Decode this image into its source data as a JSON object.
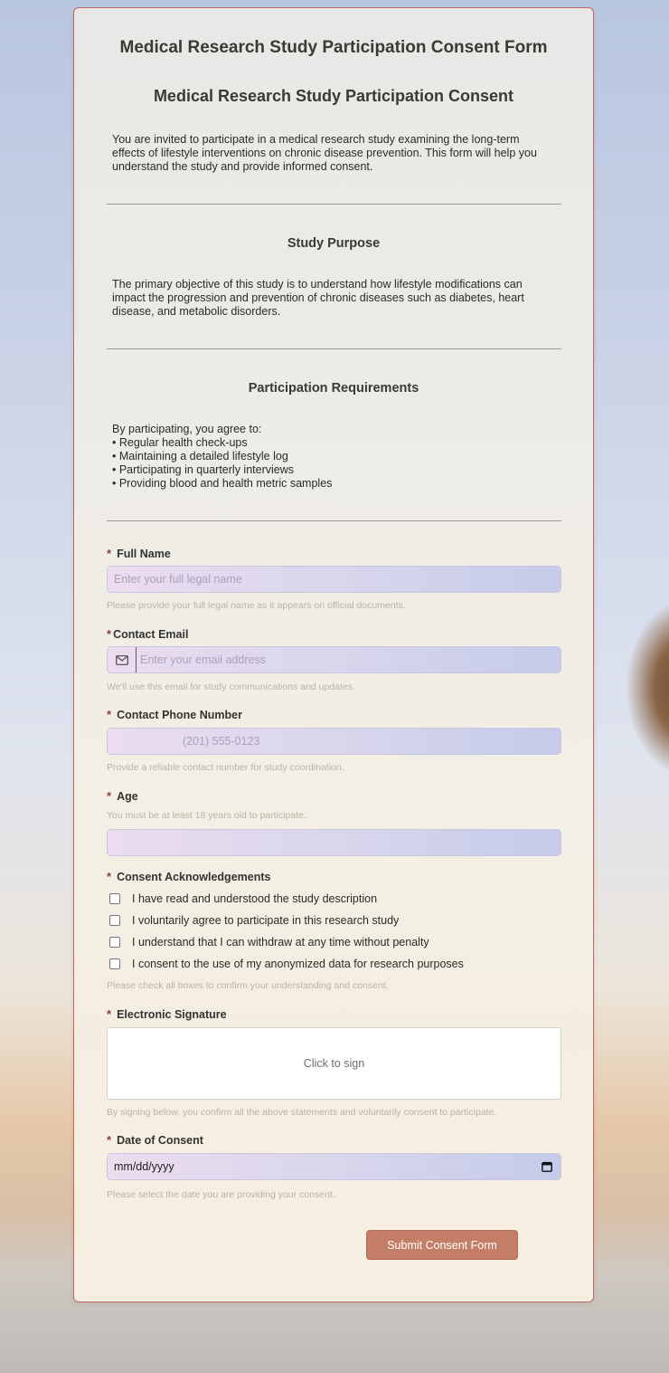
{
  "form": {
    "title": "Medical Research Study Participation Consent Form",
    "subtitle": "Medical Research Study Participation Consent",
    "intro": "You are invited to participate in a medical research study examining the long-term effects of lifestyle interventions on chronic disease prevention. This form will help you understand the study and provide informed consent."
  },
  "purpose": {
    "title": "Study Purpose",
    "text": "The primary objective of this study is to understand how lifestyle modifications can impact the progression and prevention of chronic diseases such as diabetes, heart disease, and metabolic disorders."
  },
  "requirements": {
    "title": "Participation Requirements",
    "intro": "By participating, you agree to:",
    "items": [
      "• Regular health check-ups",
      "• Maintaining a detailed lifestyle log",
      "• Participating in quarterly interviews",
      "• Providing blood and health metric samples"
    ]
  },
  "fields": {
    "full_name": {
      "label": "Full Name",
      "placeholder": "Enter your full legal name",
      "hint": "Please provide your full legal name as it appears on official documents."
    },
    "email": {
      "label": "Contact Email",
      "placeholder": "Enter your email address",
      "hint": "We'll use this email for study communications and updates."
    },
    "phone": {
      "label": "Contact Phone Number",
      "placeholder": "(201) 555-0123",
      "hint": "Provide a reliable contact number for study coordination."
    },
    "age": {
      "label": "Age",
      "hint": "You must be at least 18 years old to participate.",
      "value": ""
    },
    "consent": {
      "label": "Consent Acknowledgements",
      "items": [
        "I have read and understood the study description",
        "I voluntarily agree to participate in this research study",
        "I understand that I can withdraw at any time without penalty",
        "I consent to the use of my anonymized data for research purposes"
      ],
      "hint": "Please check all boxes to confirm your understanding and consent."
    },
    "signature": {
      "label": "Electronic Signature",
      "prompt": "Click to sign",
      "hint": "By signing below, you confirm all the above statements and voluntarily consent to participate."
    },
    "date": {
      "label": "Date of Consent",
      "placeholder": "mm/dd/yyyy",
      "hint": "Please select the date you are providing your consent."
    }
  },
  "required_marker": "*",
  "submit_label": "Submit Consent Form",
  "icons": {
    "email": "envelope-icon",
    "date": "calendar-icon"
  },
  "colors": {
    "accent": "#c47e68",
    "border": "#c4655f",
    "required": "#8f3e44"
  }
}
